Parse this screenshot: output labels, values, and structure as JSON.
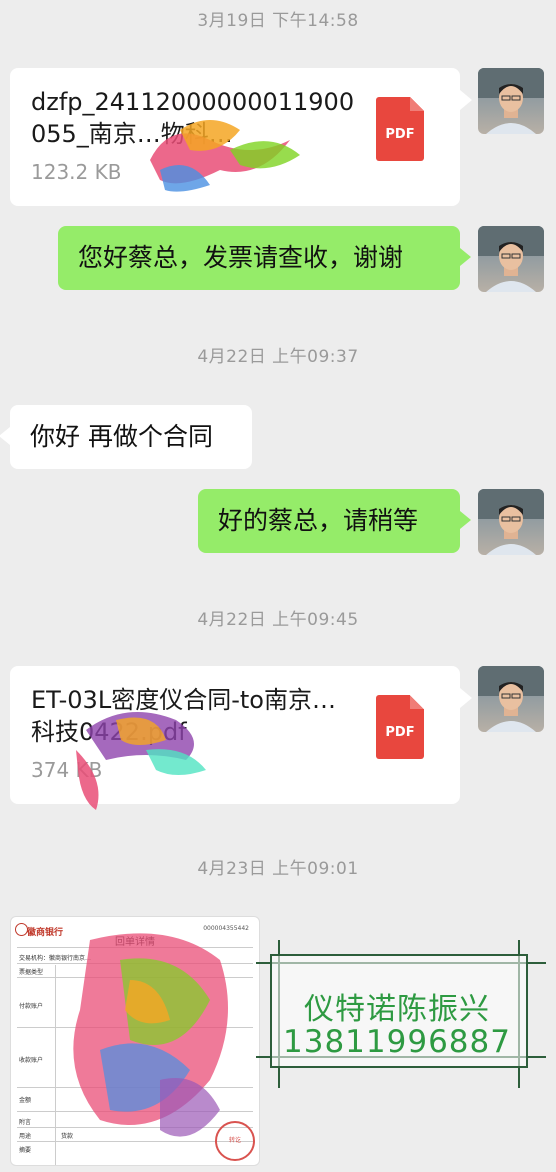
{
  "chat": {
    "ts1": "3月19日 下午14:58",
    "file1": {
      "name": "dzfp_24112000000011900055_南京…物科…",
      "size": "123.2 KB",
      "icon_label": "PDF"
    },
    "msg1": "您好蔡总，发票请查收，谢谢",
    "ts2": "4月22日 上午09:37",
    "msg2": "你好 再做个合同",
    "msg3": "好的蔡总，请稍等",
    "ts3": "4月22日 上午09:45",
    "file2": {
      "name": "ET-03L密度仪合同-to南京…科技0422.pdf",
      "size": "374 KB",
      "icon_label": "PDF"
    },
    "ts4": "4月23日 上午09:01",
    "receipt": {
      "bank": "徽商银行",
      "title": "回单详情",
      "no": "000004355442",
      "rows": [
        "交易机构：徽商银行南京…",
        "票据类型",
        "付款账户",
        "收款账户",
        "金额",
        "附言",
        "用途",
        "摘要"
      ],
      "purpose": "货款",
      "stamp": "转讫"
    },
    "watermark": {
      "name": "仪特诺陈振兴",
      "phone": "13811996887"
    }
  },
  "colors": {
    "bubble_green": "#95ec69",
    "bg": "#ededed",
    "pdf_red": "#e8473e",
    "watermark_green": "#2e9a42"
  }
}
